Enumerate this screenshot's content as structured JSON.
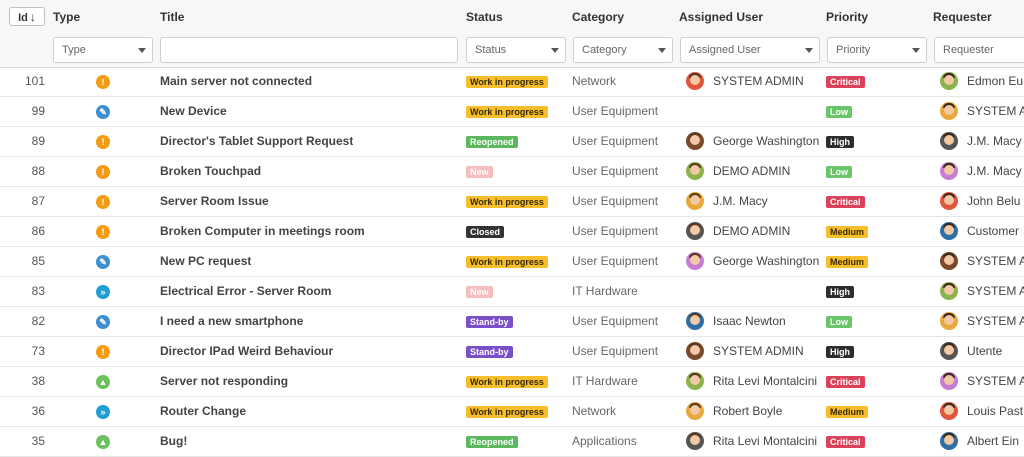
{
  "columns": {
    "id": "Id",
    "type": "Type",
    "title": "Title",
    "status": "Status",
    "category": "Category",
    "assigned": "Assigned User",
    "priority": "Priority",
    "requester": "Requester"
  },
  "filters": {
    "type": "Type",
    "title": "",
    "status": "Status",
    "category": "Category",
    "assigned": "Assigned User",
    "priority": "Priority",
    "requester": "Requester"
  },
  "colors": {
    "incident": "#f39c12",
    "request": "#3d8fd1",
    "change": "#1f9fd6",
    "problem": "#6cc05d"
  },
  "rows": [
    {
      "id": "101",
      "type": "incident-icon",
      "title": "Main server not connected",
      "status": "Work in progress",
      "category": "Network",
      "assigned": "SYSTEM ADMIN",
      "priority": "Critical",
      "requester": "Edmon Eu"
    },
    {
      "id": "99",
      "type": "request-icon",
      "title": "New Device",
      "status": "Work in progress",
      "category": "User Equipment",
      "assigned": "",
      "priority": "Low",
      "requester": "SYSTEM A"
    },
    {
      "id": "89",
      "type": "incident-icon",
      "title": "Director's Tablet Support Request",
      "status": "Reopened",
      "category": "User Equipment",
      "assigned": "George Washington",
      "priority": "High",
      "requester": "J.M. Macy"
    },
    {
      "id": "88",
      "type": "incident-icon",
      "title": "Broken Touchpad",
      "status": "New",
      "category": "User Equipment",
      "assigned": "DEMO ADMIN",
      "priority": "Low",
      "requester": "J.M. Macy"
    },
    {
      "id": "87",
      "type": "incident-icon",
      "title": "Server Room Issue",
      "status": "Work in progress",
      "category": "User Equipment",
      "assigned": "J.M. Macy",
      "priority": "Critical",
      "requester": "John Belu"
    },
    {
      "id": "86",
      "type": "incident-icon",
      "title": "Broken Computer in meetings room",
      "status": "Closed",
      "category": "User Equipment",
      "assigned": "DEMO ADMIN",
      "priority": "Medium",
      "requester": "Customer"
    },
    {
      "id": "85",
      "type": "request-icon",
      "title": "New PC request",
      "status": "Work in progress",
      "category": "User Equipment",
      "assigned": "George Washington",
      "priority": "Medium",
      "requester": "SYSTEM A"
    },
    {
      "id": "83",
      "type": "change-icon",
      "title": "Electrical Error - Server Room",
      "status": "New",
      "category": "IT Hardware",
      "assigned": "",
      "priority": "High",
      "requester": "SYSTEM A"
    },
    {
      "id": "82",
      "type": "request-icon",
      "title": "I need a new smartphone",
      "status": "Stand-by",
      "category": "User Equipment",
      "assigned": "Isaac Newton",
      "priority": "Low",
      "requester": "SYSTEM A"
    },
    {
      "id": "73",
      "type": "incident-icon",
      "title": "Director IPad Weird Behaviour",
      "status": "Stand-by",
      "category": "User Equipment",
      "assigned": "SYSTEM ADMIN",
      "priority": "High",
      "requester": "Utente"
    },
    {
      "id": "38",
      "type": "problem-icon",
      "title": "Server not responding",
      "status": "Work in progress",
      "category": "IT Hardware",
      "assigned": "Rita Levi Montalcini",
      "priority": "Critical",
      "requester": "SYSTEM A"
    },
    {
      "id": "36",
      "type": "change-icon",
      "title": "Router Change",
      "status": "Work in progress",
      "category": "Network",
      "assigned": "Robert Boyle",
      "priority": "Medium",
      "requester": "Louis Past"
    },
    {
      "id": "35",
      "type": "problem-icon",
      "title": "Bug!",
      "status": "Reopened",
      "category": "Applications",
      "assigned": "Rita Levi Montalcini",
      "priority": "Critical",
      "requester": "Albert Ein"
    }
  ]
}
